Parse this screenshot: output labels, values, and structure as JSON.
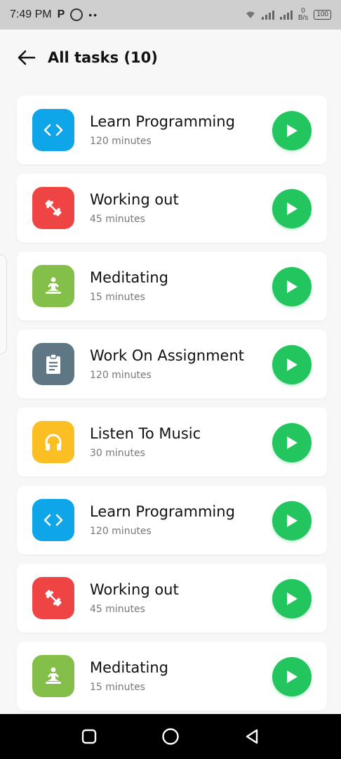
{
  "status_bar": {
    "time": "7:49 PM",
    "app_icon_p": "P",
    "dots": "••",
    "net_speed_value": "0",
    "net_speed_unit": "B/s",
    "battery": "100"
  },
  "header": {
    "title": "All tasks (10)"
  },
  "tasks": [
    {
      "title": "Learn Programming",
      "duration": "120 minutes",
      "color": "#0ea5e9",
      "icon": "code-icon"
    },
    {
      "title": "Working out",
      "duration": "45 minutes",
      "color": "#ef4444",
      "icon": "dumbbell-icon"
    },
    {
      "title": "Meditating",
      "duration": "15 minutes",
      "color": "#84c049",
      "icon": "meditation-icon"
    },
    {
      "title": "Work On Assignment",
      "duration": "120 minutes",
      "color": "#5f7784",
      "icon": "assignment-icon"
    },
    {
      "title": "Listen To Music",
      "duration": "30 minutes",
      "color": "#fbbf24",
      "icon": "headphones-icon"
    },
    {
      "title": "Learn Programming",
      "duration": "120 minutes",
      "color": "#0ea5e9",
      "icon": "code-icon"
    },
    {
      "title": "Working out",
      "duration": "45 minutes",
      "color": "#ef4444",
      "icon": "dumbbell-icon"
    },
    {
      "title": "Meditating",
      "duration": "15 minutes",
      "color": "#84c049",
      "icon": "meditation-icon"
    }
  ],
  "colors": {
    "play": "#22c55e",
    "status_bar": "#cfcfcf",
    "nav_bar": "#000000"
  }
}
